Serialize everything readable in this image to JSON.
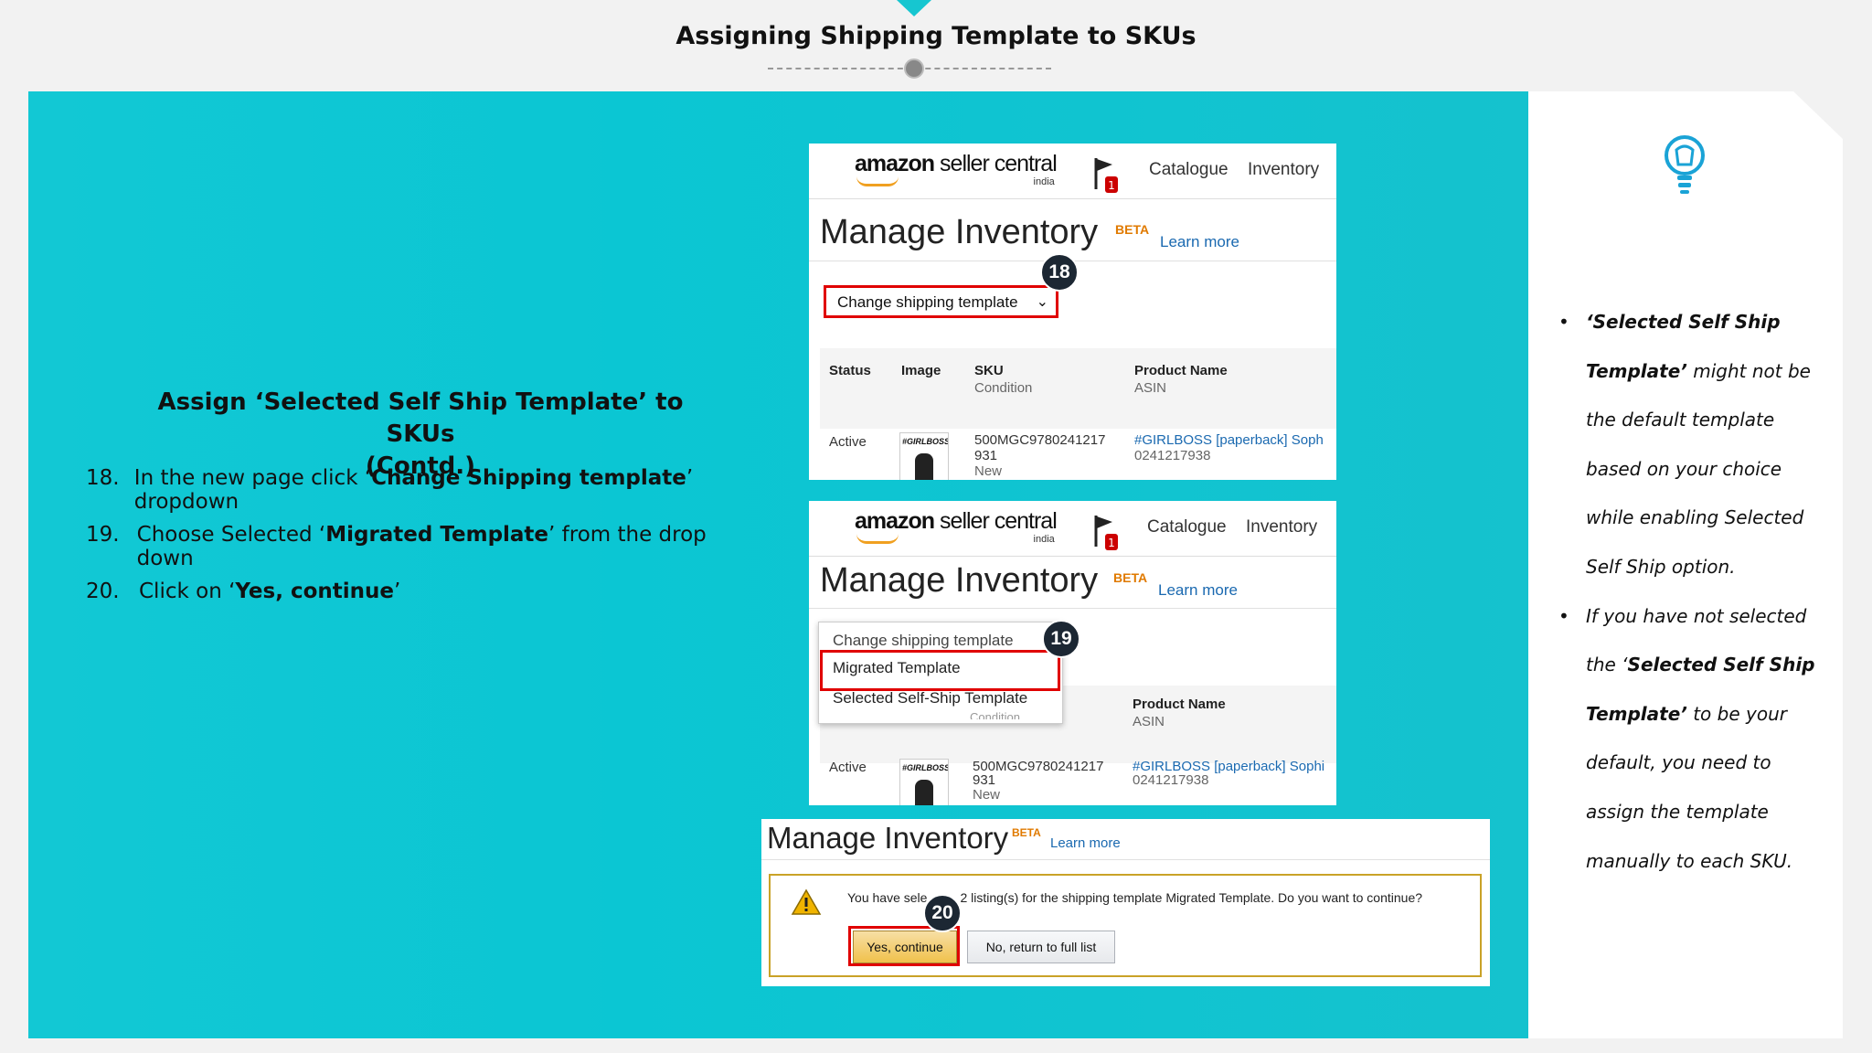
{
  "slide": {
    "title": "Assigning Shipping Template to SKUs"
  },
  "left": {
    "heading_line1": "Assign ‘Selected Self Ship Template’ to SKUs",
    "heading_line2": "(Contd.)",
    "steps": [
      {
        "num": "18.",
        "pre": "In the new page click ‘",
        "bold": "Change Shipping template",
        "post": "’ dropdown"
      },
      {
        "num": "19.",
        "pre": "Choose Selected ‘",
        "bold": "Migrated Template",
        "post": "’ from the drop down"
      },
      {
        "num": "20.",
        "pre": "Click on ‘",
        "bold": "Yes, continue",
        "post": "’"
      }
    ]
  },
  "seller": {
    "logo_amazon": "amazon",
    "logo_seller": " seller central",
    "logo_india": "india",
    "flag_count": "1",
    "nav_catalogue": "Catalogue",
    "nav_inventory": "Inventory",
    "page_title": "Manage Inventory",
    "beta": "BETA",
    "learn_more": "Learn more"
  },
  "card1": {
    "badge": "18",
    "dropdown_label": "Change shipping template",
    "columns": {
      "status": "Status",
      "image": "Image",
      "sku": "SKU",
      "condition": "Condition",
      "product_name": "Product Name",
      "asin": "ASIN"
    },
    "row": {
      "status": "Active",
      "thumb_text": "#GIRLBOSS",
      "sku_line1": "500MGC9780241217",
      "sku_line2": "931",
      "condition": "New",
      "product": "#GIRLBOSS [paperback] Soph",
      "asin": "0241217938"
    }
  },
  "card2": {
    "badge": "19",
    "menu_header": "Change shipping template",
    "menu_item1": "Migrated Template",
    "menu_item2": "Selected Self-Ship Template",
    "menu_cut": "Condition",
    "product_name": "Product Name",
    "asin": "ASIN",
    "row": {
      "status": "Active",
      "thumb_text": "#GIRLBOSS",
      "sku_line1": "500MGC9780241217",
      "sku_line2": "931",
      "condition": "New",
      "product": "#GIRLBOSS [paperback] Sophi",
      "asin": "0241217938"
    }
  },
  "card3": {
    "page_title": "Manage Inventory",
    "beta": "BETA",
    "learn_more": "Learn more",
    "badge": "20",
    "alert_pre": "You have sele",
    "alert_post": "2 listing(s) for the shipping template Migrated Template. Do you want to continue?",
    "btn_yes": "Yes, continue",
    "btn_no": "No, return to full list"
  },
  "tips": {
    "tip1_b1": "‘Selected Self Ship Template’",
    "tip1_rest": " might not be the default template based on your choice while enabling Selected Self Ship option.",
    "tip2_pre": "If you have not selected the ‘",
    "tip2_b": "Selected Self Ship Template’",
    "tip2_rest": " to be your default, you need to assign the template manually to each SKU."
  },
  "colors": {
    "teal": "#12c8d4",
    "highlight_red": "#e00000",
    "badge_dark": "#1c2733",
    "link_blue": "#1a69b0"
  }
}
